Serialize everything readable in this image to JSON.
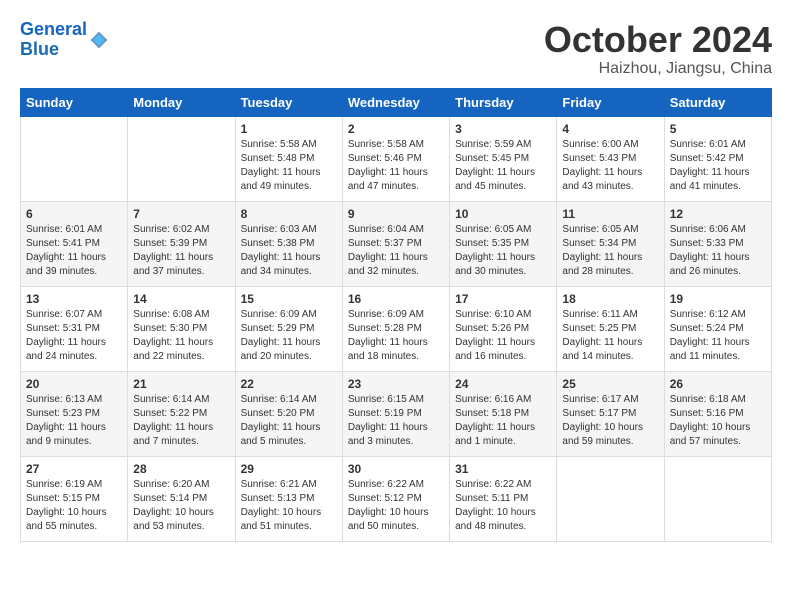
{
  "header": {
    "logo_line1": "General",
    "logo_line2": "Blue",
    "month": "October 2024",
    "location": "Haizhou, Jiangsu, China"
  },
  "days_of_week": [
    "Sunday",
    "Monday",
    "Tuesday",
    "Wednesday",
    "Thursday",
    "Friday",
    "Saturday"
  ],
  "weeks": [
    [
      {
        "day": "",
        "info": ""
      },
      {
        "day": "",
        "info": ""
      },
      {
        "day": "1",
        "info": "Sunrise: 5:58 AM\nSunset: 5:48 PM\nDaylight: 11 hours and 49 minutes."
      },
      {
        "day": "2",
        "info": "Sunrise: 5:58 AM\nSunset: 5:46 PM\nDaylight: 11 hours and 47 minutes."
      },
      {
        "day": "3",
        "info": "Sunrise: 5:59 AM\nSunset: 5:45 PM\nDaylight: 11 hours and 45 minutes."
      },
      {
        "day": "4",
        "info": "Sunrise: 6:00 AM\nSunset: 5:43 PM\nDaylight: 11 hours and 43 minutes."
      },
      {
        "day": "5",
        "info": "Sunrise: 6:01 AM\nSunset: 5:42 PM\nDaylight: 11 hours and 41 minutes."
      }
    ],
    [
      {
        "day": "6",
        "info": "Sunrise: 6:01 AM\nSunset: 5:41 PM\nDaylight: 11 hours and 39 minutes."
      },
      {
        "day": "7",
        "info": "Sunrise: 6:02 AM\nSunset: 5:39 PM\nDaylight: 11 hours and 37 minutes."
      },
      {
        "day": "8",
        "info": "Sunrise: 6:03 AM\nSunset: 5:38 PM\nDaylight: 11 hours and 34 minutes."
      },
      {
        "day": "9",
        "info": "Sunrise: 6:04 AM\nSunset: 5:37 PM\nDaylight: 11 hours and 32 minutes."
      },
      {
        "day": "10",
        "info": "Sunrise: 6:05 AM\nSunset: 5:35 PM\nDaylight: 11 hours and 30 minutes."
      },
      {
        "day": "11",
        "info": "Sunrise: 6:05 AM\nSunset: 5:34 PM\nDaylight: 11 hours and 28 minutes."
      },
      {
        "day": "12",
        "info": "Sunrise: 6:06 AM\nSunset: 5:33 PM\nDaylight: 11 hours and 26 minutes."
      }
    ],
    [
      {
        "day": "13",
        "info": "Sunrise: 6:07 AM\nSunset: 5:31 PM\nDaylight: 11 hours and 24 minutes."
      },
      {
        "day": "14",
        "info": "Sunrise: 6:08 AM\nSunset: 5:30 PM\nDaylight: 11 hours and 22 minutes."
      },
      {
        "day": "15",
        "info": "Sunrise: 6:09 AM\nSunset: 5:29 PM\nDaylight: 11 hours and 20 minutes."
      },
      {
        "day": "16",
        "info": "Sunrise: 6:09 AM\nSunset: 5:28 PM\nDaylight: 11 hours and 18 minutes."
      },
      {
        "day": "17",
        "info": "Sunrise: 6:10 AM\nSunset: 5:26 PM\nDaylight: 11 hours and 16 minutes."
      },
      {
        "day": "18",
        "info": "Sunrise: 6:11 AM\nSunset: 5:25 PM\nDaylight: 11 hours and 14 minutes."
      },
      {
        "day": "19",
        "info": "Sunrise: 6:12 AM\nSunset: 5:24 PM\nDaylight: 11 hours and 11 minutes."
      }
    ],
    [
      {
        "day": "20",
        "info": "Sunrise: 6:13 AM\nSunset: 5:23 PM\nDaylight: 11 hours and 9 minutes."
      },
      {
        "day": "21",
        "info": "Sunrise: 6:14 AM\nSunset: 5:22 PM\nDaylight: 11 hours and 7 minutes."
      },
      {
        "day": "22",
        "info": "Sunrise: 6:14 AM\nSunset: 5:20 PM\nDaylight: 11 hours and 5 minutes."
      },
      {
        "day": "23",
        "info": "Sunrise: 6:15 AM\nSunset: 5:19 PM\nDaylight: 11 hours and 3 minutes."
      },
      {
        "day": "24",
        "info": "Sunrise: 6:16 AM\nSunset: 5:18 PM\nDaylight: 11 hours and 1 minute."
      },
      {
        "day": "25",
        "info": "Sunrise: 6:17 AM\nSunset: 5:17 PM\nDaylight: 10 hours and 59 minutes."
      },
      {
        "day": "26",
        "info": "Sunrise: 6:18 AM\nSunset: 5:16 PM\nDaylight: 10 hours and 57 minutes."
      }
    ],
    [
      {
        "day": "27",
        "info": "Sunrise: 6:19 AM\nSunset: 5:15 PM\nDaylight: 10 hours and 55 minutes."
      },
      {
        "day": "28",
        "info": "Sunrise: 6:20 AM\nSunset: 5:14 PM\nDaylight: 10 hours and 53 minutes."
      },
      {
        "day": "29",
        "info": "Sunrise: 6:21 AM\nSunset: 5:13 PM\nDaylight: 10 hours and 51 minutes."
      },
      {
        "day": "30",
        "info": "Sunrise: 6:22 AM\nSunset: 5:12 PM\nDaylight: 10 hours and 50 minutes."
      },
      {
        "day": "31",
        "info": "Sunrise: 6:22 AM\nSunset: 5:11 PM\nDaylight: 10 hours and 48 minutes."
      },
      {
        "day": "",
        "info": ""
      },
      {
        "day": "",
        "info": ""
      }
    ]
  ]
}
